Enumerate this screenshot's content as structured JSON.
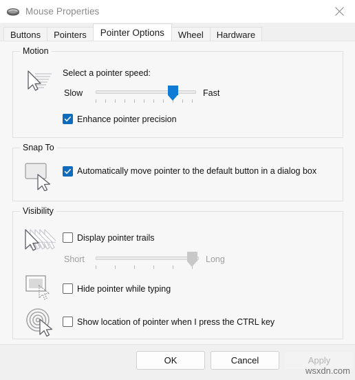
{
  "window": {
    "title": "Mouse Properties",
    "icon": "mouse-icon",
    "close_icon": "close-icon"
  },
  "tabs": [
    {
      "label": "Buttons",
      "selected": false
    },
    {
      "label": "Pointers",
      "selected": false
    },
    {
      "label": "Pointer Options",
      "selected": true
    },
    {
      "label": "Wheel",
      "selected": false
    },
    {
      "label": "Hardware",
      "selected": false
    }
  ],
  "colors": {
    "accent": "#0f6cbd",
    "slider_thumb": "#0f7bd4",
    "disabled_text": "#9e9e9e",
    "window_bg": "#f7f7f7",
    "footer_bg": "#f0f0f0"
  },
  "groups": {
    "motion": {
      "title": "Motion",
      "icon": "pointer-speed-icon",
      "speed_prompt": "Select a pointer speed:",
      "slider": {
        "name": "pointer-speed-slider",
        "min_label": "Slow",
        "max_label": "Fast",
        "ticks": 11,
        "value": 9,
        "max": 11,
        "enabled": true
      },
      "enhance_precision": {
        "label": "Enhance pointer precision",
        "checked": true
      }
    },
    "snap_to": {
      "title": "Snap To",
      "icon": "snap-to-default-button-icon",
      "auto_move": {
        "label": "Automatically move pointer to the default button in a dialog box",
        "checked": true
      }
    },
    "visibility": {
      "title": "Visibility",
      "trails": {
        "icon": "pointer-trails-icon",
        "label": "Display pointer trails",
        "checked": false,
        "slider": {
          "name": "pointer-trails-slider",
          "min_label": "Short",
          "max_label": "Long",
          "ticks": 6,
          "value": 5,
          "max": 6,
          "enabled": false
        }
      },
      "hide_typing": {
        "icon": "hide-pointer-typing-icon",
        "label": "Hide pointer while typing",
        "checked": false
      },
      "show_location": {
        "icon": "show-pointer-location-icon",
        "label": "Show location of pointer when I press the CTRL key",
        "checked": false
      }
    }
  },
  "footer": {
    "ok": "OK",
    "cancel": "Cancel",
    "apply": "Apply",
    "apply_enabled": false
  },
  "watermark": "wsxdn.com"
}
